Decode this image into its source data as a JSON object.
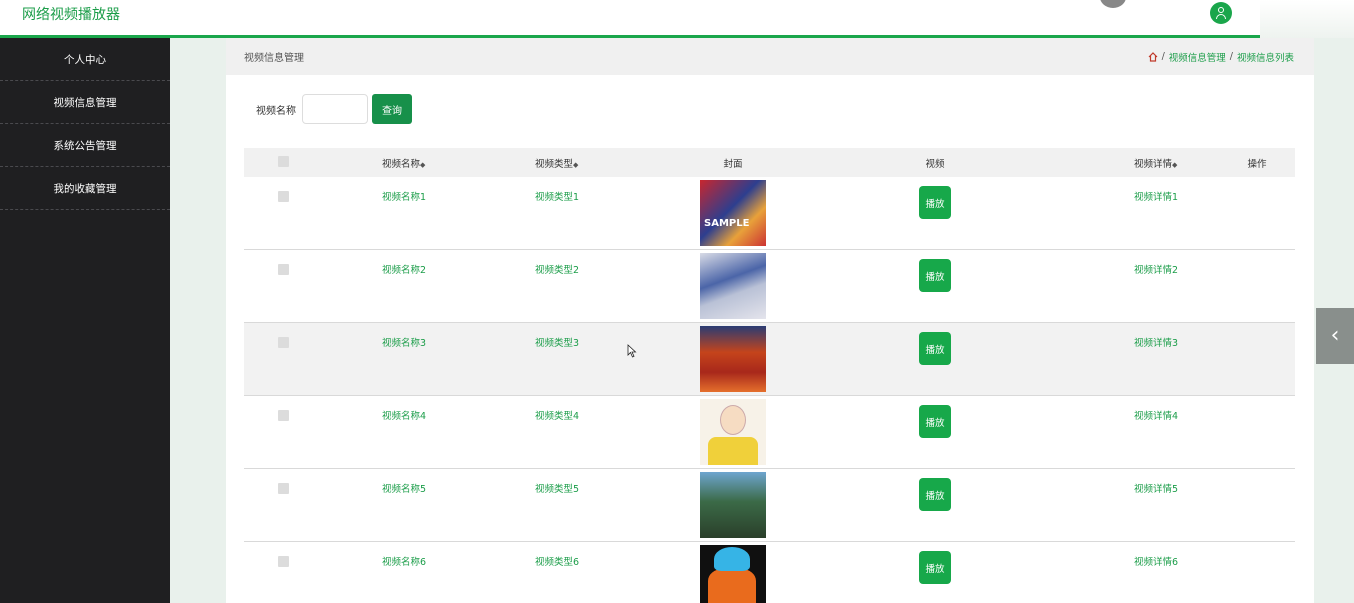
{
  "header": {
    "app_title": "网络视频播放器"
  },
  "sidebar": {
    "items": [
      {
        "label": "个人中心"
      },
      {
        "label": "视频信息管理"
      },
      {
        "label": "系统公告管理"
      },
      {
        "label": "我的收藏管理"
      }
    ]
  },
  "page": {
    "title": "视频信息管理",
    "breadcrumb": {
      "sep": "/",
      "level1": "视频信息管理",
      "level2": "视频信息列表"
    }
  },
  "search": {
    "label": "视频名称",
    "value": "",
    "button": "查询"
  },
  "table": {
    "columns": {
      "name": "视频名称",
      "type": "视频类型",
      "cover": "封面",
      "video": "视频",
      "detail": "视频详情",
      "action": "操作"
    },
    "sort_mark": "◆",
    "rows": [
      {
        "name": "视频名称1",
        "type": "视频类型1",
        "play": "播放",
        "detail": "视频详情1",
        "cover_text": "SAMPLE"
      },
      {
        "name": "视频名称2",
        "type": "视频类型2",
        "play": "播放",
        "detail": "视频详情2"
      },
      {
        "name": "视频名称3",
        "type": "视频类型3",
        "play": "播放",
        "detail": "视频详情3"
      },
      {
        "name": "视频名称4",
        "type": "视频类型4",
        "play": "播放",
        "detail": "视频详情4"
      },
      {
        "name": "视频名称5",
        "type": "视频类型5",
        "play": "播放",
        "detail": "视频详情5"
      },
      {
        "name": "视频名称6",
        "type": "视频类型6",
        "play": "播放",
        "detail": "视频详情6"
      }
    ]
  },
  "side_tab": {
    "icon": "chevron-left-icon",
    "glyph": "‹"
  },
  "colors": {
    "accent": "#1aa64b",
    "sidebar_bg": "#1f1f21",
    "page_bg": "#e9f1ec"
  }
}
